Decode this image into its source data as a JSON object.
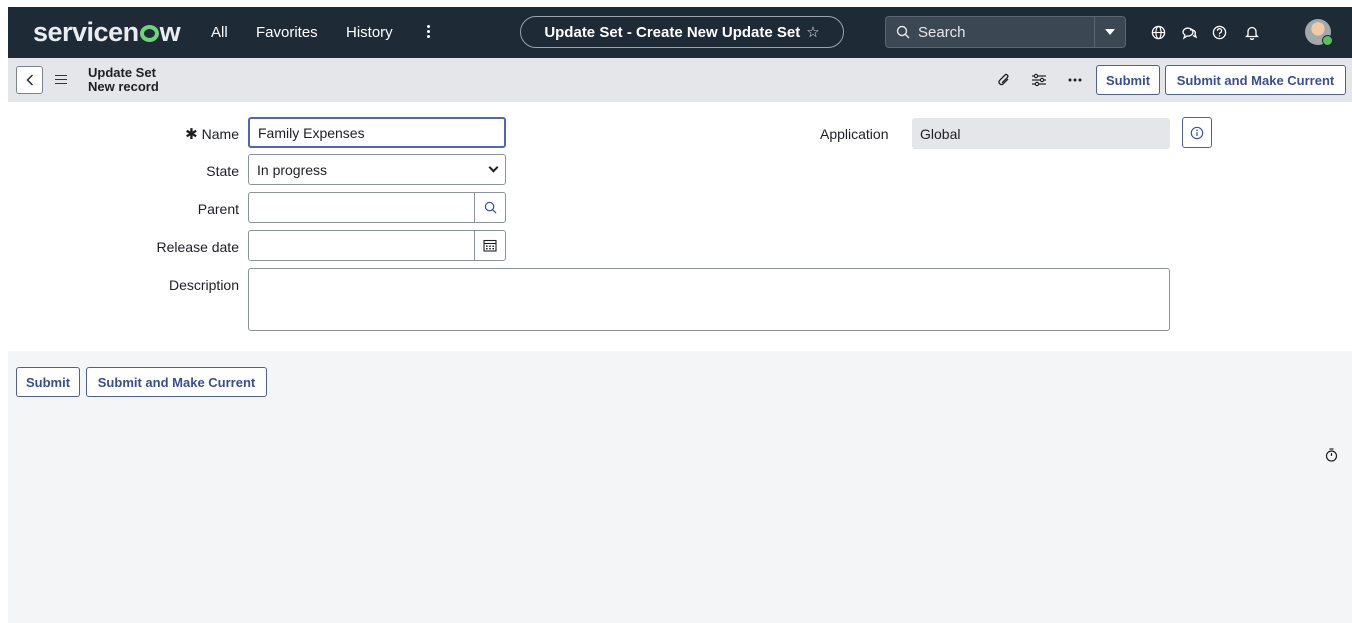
{
  "topbar": {
    "logo_left": "servicen",
    "logo_right": "w",
    "nav": {
      "all": "All",
      "favorites": "Favorites",
      "history": "History"
    },
    "page_title": "Update Set - Create New Update Set",
    "star_glyph": "☆",
    "search": {
      "placeholder": "Search"
    },
    "icons": [
      "globe-icon",
      "chat-icon",
      "help-icon",
      "bell-icon"
    ]
  },
  "header": {
    "table_name": "Update Set",
    "record_name": "New record",
    "submit_label": "Submit",
    "submit_current_label": "Submit and Make Current"
  },
  "form": {
    "name_label": "Name",
    "name_value": "Family Expenses",
    "state_label": "State",
    "state_value": "In progress",
    "parent_label": "Parent",
    "parent_value": "",
    "release_label": "Release date",
    "release_value": "",
    "description_label": "Description",
    "description_value": "",
    "application_label": "Application",
    "application_value": "Global"
  },
  "footer": {
    "submit_label": "Submit",
    "submit_current_label": "Submit and Make Current"
  },
  "colors": {
    "topbar": "#1f2a37",
    "accent": "#3a4d9c",
    "header_bg": "#e4e6e9",
    "bottom_bg": "#f4f5f6"
  }
}
